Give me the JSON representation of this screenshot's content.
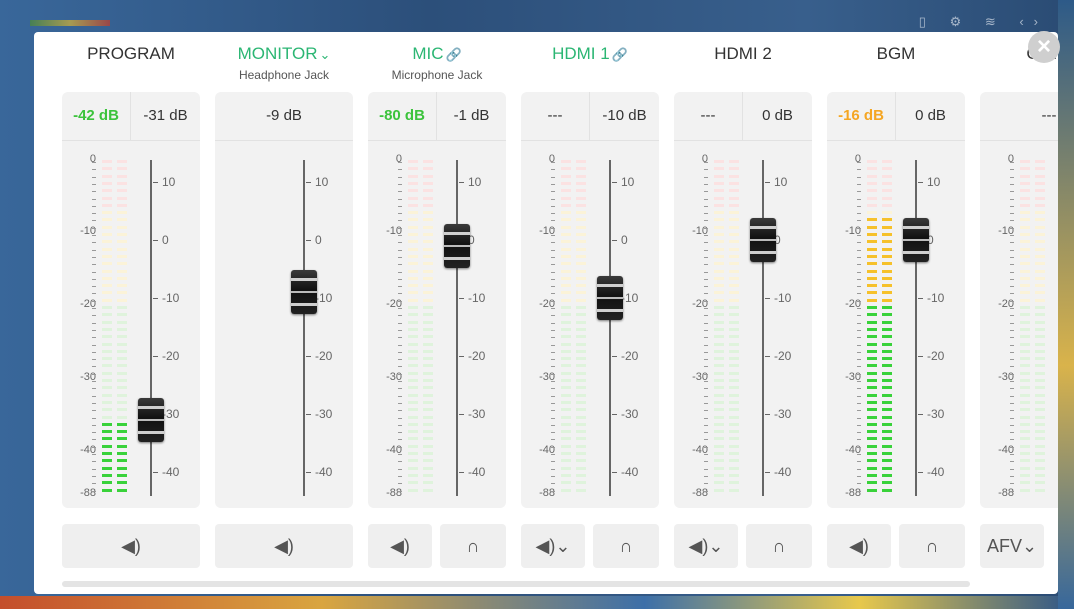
{
  "window": {
    "close_glyph": "×"
  },
  "scroll": {
    "position": "start"
  },
  "meter_scale": [
    "0",
    "-10",
    "-20",
    "-30",
    "-40",
    "-88"
  ],
  "fader_scale": [
    "10",
    "0",
    "-10",
    "-20",
    "-30",
    "-40"
  ],
  "meter_colors": {
    "green_on": "#39d23a",
    "green_off": "#dff3dc",
    "yellow_on": "#f6c12a",
    "yellow_off": "#fbf3d8",
    "red_on": "#e63b3b",
    "red_off": "#fbe2e2"
  },
  "channels": [
    {
      "name": "PROGRAM",
      "subtitle": "",
      "name_color": "default",
      "title_suffix": "",
      "db_left": "-42 dB",
      "db_left_color": "green",
      "db_right": "-31 dB",
      "meter": {
        "columns": 2,
        "level_db": -36
      },
      "fader": {
        "has_scale": true,
        "level_db": -31
      },
      "buttons": [
        {
          "label": "◀)",
          "icon": "speaker-icon",
          "kind": "full"
        }
      ]
    },
    {
      "name": "MONITOR",
      "subtitle": "Headphone Jack",
      "name_color": "green",
      "title_suffix": "⌄",
      "db_left": "",
      "db_left_color": "",
      "db_right": "-9 dB",
      "meter": {
        "columns": 0,
        "level_db": null
      },
      "fader": {
        "has_scale": true,
        "level_db": -9
      },
      "buttons": [
        {
          "label": "◀)",
          "icon": "speaker-icon",
          "kind": "full"
        }
      ]
    },
    {
      "name": "MIC",
      "subtitle": "Microphone Jack",
      "name_color": "green",
      "title_suffix": "🔗",
      "db_left": "-80 dB",
      "db_left_color": "green",
      "db_right": "-1 dB",
      "meter": {
        "columns": 2,
        "level_db": -86
      },
      "fader": {
        "has_scale": true,
        "level_db": -1
      },
      "buttons": [
        {
          "label": "◀)",
          "icon": "speaker-icon",
          "kind": "l"
        },
        {
          "label": "∩",
          "icon": "headphone-icon",
          "kind": "r"
        }
      ]
    },
    {
      "name": "HDMI 1",
      "subtitle": "",
      "name_color": "green",
      "title_suffix": "🔗",
      "db_left": "---",
      "db_left_color": "",
      "db_right": "-10 dB",
      "meter": {
        "columns": 2,
        "level_db": null
      },
      "fader": {
        "has_scale": true,
        "level_db": -10
      },
      "buttons": [
        {
          "label": "◀)⌄",
          "icon": "speaker-dropdown-icon",
          "kind": "l"
        },
        {
          "label": "∩",
          "icon": "headphone-icon",
          "kind": "r"
        }
      ]
    },
    {
      "name": "HDMI 2",
      "subtitle": "",
      "name_color": "default",
      "title_suffix": "",
      "db_left": "---",
      "db_left_color": "",
      "db_right": "0 dB",
      "meter": {
        "columns": 2,
        "level_db": null
      },
      "fader": {
        "has_scale": true,
        "level_db": 0
      },
      "buttons": [
        {
          "label": "◀)⌄",
          "icon": "speaker-dropdown-icon",
          "kind": "l"
        },
        {
          "label": "∩",
          "icon": "headphone-icon",
          "kind": "r"
        }
      ]
    },
    {
      "name": "BGM",
      "subtitle": "",
      "name_color": "default",
      "title_suffix": "",
      "db_left": "-16 dB",
      "db_left_color": "orange",
      "db_right": "0 dB",
      "meter": {
        "columns": 2,
        "level_db": -8
      },
      "fader": {
        "has_scale": true,
        "level_db": 0
      },
      "buttons": [
        {
          "label": "◀)",
          "icon": "speaker-icon",
          "kind": "l"
        },
        {
          "label": "∩",
          "icon": "headphone-icon",
          "kind": "r"
        }
      ]
    },
    {
      "name": "Came",
      "subtitle": "",
      "name_color": "default",
      "title_suffix": "",
      "db_left": "---",
      "db_left_color": "",
      "db_right": "",
      "meter": {
        "columns": 2,
        "level_db": null
      },
      "fader": {
        "has_scale": false,
        "level_db": null
      },
      "buttons": [
        {
          "label": "AFV⌄",
          "icon": "afv-dropdown",
          "kind": "l"
        }
      ]
    }
  ]
}
